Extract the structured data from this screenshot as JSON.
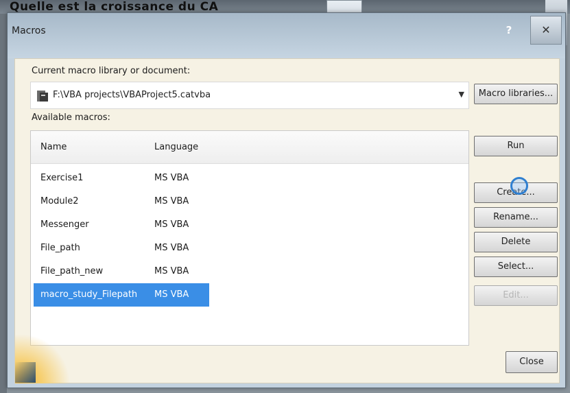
{
  "background": {
    "window_title": "Quelle est la croissance du CA"
  },
  "dialog": {
    "title": "Macros",
    "help_label": "?",
    "close_label": "✕"
  },
  "current_label": "Current macro library or document:",
  "library_path": "F:\\VBA projects\\VBAProject5.catvba",
  "available_label": "Available macros:",
  "list": {
    "headers": {
      "name": "Name",
      "language": "Language"
    },
    "rows": [
      {
        "name": "Exercise1",
        "language": "MS VBA"
      },
      {
        "name": "Module2",
        "language": "MS VBA"
      },
      {
        "name": "Messenger",
        "language": "MS VBA"
      },
      {
        "name": "File_path",
        "language": "MS VBA"
      },
      {
        "name": "File_path_new",
        "language": "MS VBA"
      },
      {
        "name": "macro_study_Filepath",
        "language": "MS VBA"
      }
    ],
    "selected_index": 5
  },
  "buttons": {
    "macro_libraries": "Macro libraries...",
    "run": "Run",
    "create": "Create...",
    "rename": "Rename...",
    "delete": "Delete",
    "select": "Select...",
    "disabled": "Edit...",
    "close": "Close"
  },
  "colors": {
    "selection": "#3a8ee6",
    "panel": "#f6f2e4",
    "frame": "#c3d2df"
  }
}
